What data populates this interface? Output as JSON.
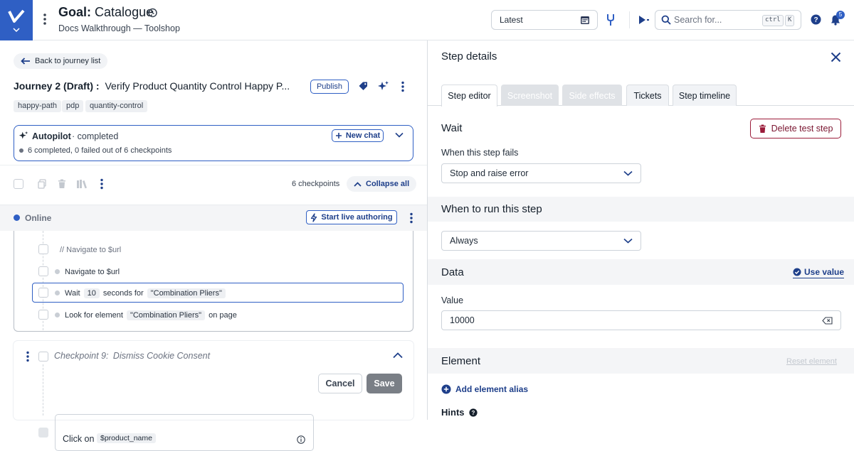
{
  "header": {
    "goal_prefix": "Goal:",
    "goal_name": "Catalogue",
    "subtitle": "Docs Walkthrough — Toolshop",
    "date_picker_value": "Latest",
    "search_placeholder": "Search for...",
    "shortcut_key1": "ctrl",
    "shortcut_key2": "K",
    "notification_count": "5"
  },
  "journey": {
    "back_label": "Back to journey list",
    "title": "Journey 2 (Draft) :",
    "name": "Verify Product Quantity Control Happy P...",
    "publish_label": "Publish",
    "tags": [
      "happy-path",
      "pdp",
      "quantity-control"
    ]
  },
  "autopilot": {
    "title": "Autopilot",
    "status": "· completed",
    "new_chat_label": "New chat",
    "summary": "6 completed, 0 failed out of 6 checkpoints"
  },
  "toolbar": {
    "checkpoints_count": "6 checkpoints",
    "collapse_label": "Collapse all"
  },
  "live": {
    "status": "Online",
    "start_label": "Start live authoring"
  },
  "steps": {
    "comment": "// Navigate to $url",
    "navigate": "Navigate to $url",
    "wait_prefix": "Wait",
    "wait_value": "10",
    "wait_middle": "seconds for",
    "wait_target": "\"Combination Pliers\"",
    "look_prefix": "Look for element",
    "look_target": "\"Combination Pliers\"",
    "look_suffix": "on page"
  },
  "checkpoint9": {
    "label": "Checkpoint 9:",
    "name": "Dismiss Cookie Consent",
    "input_prefix": "Click on",
    "input_variable": "$product_name",
    "cancel_label": "Cancel",
    "save_label": "Save"
  },
  "details": {
    "title": "Step details",
    "tabs": [
      "Step editor",
      "Screenshot",
      "Side effects",
      "Tickets",
      "Step timeline"
    ],
    "step_type": "Wait",
    "delete_label": "Delete test step",
    "fail_label": "When this step fails",
    "fail_value": "Stop and raise error",
    "run_section": "When to run this step",
    "run_value": "Always",
    "data_section": "Data",
    "use_value_label": "Use value",
    "value_label": "Value",
    "value": "10000",
    "element_section": "Element",
    "reset_element_label": "Reset element",
    "add_alias_label": "Add element alias",
    "hints_label": "Hints"
  },
  "colors": {
    "brand": "#2f5fc4",
    "danger": "#9b1c3a",
    "save_button": "#7a7f86"
  }
}
